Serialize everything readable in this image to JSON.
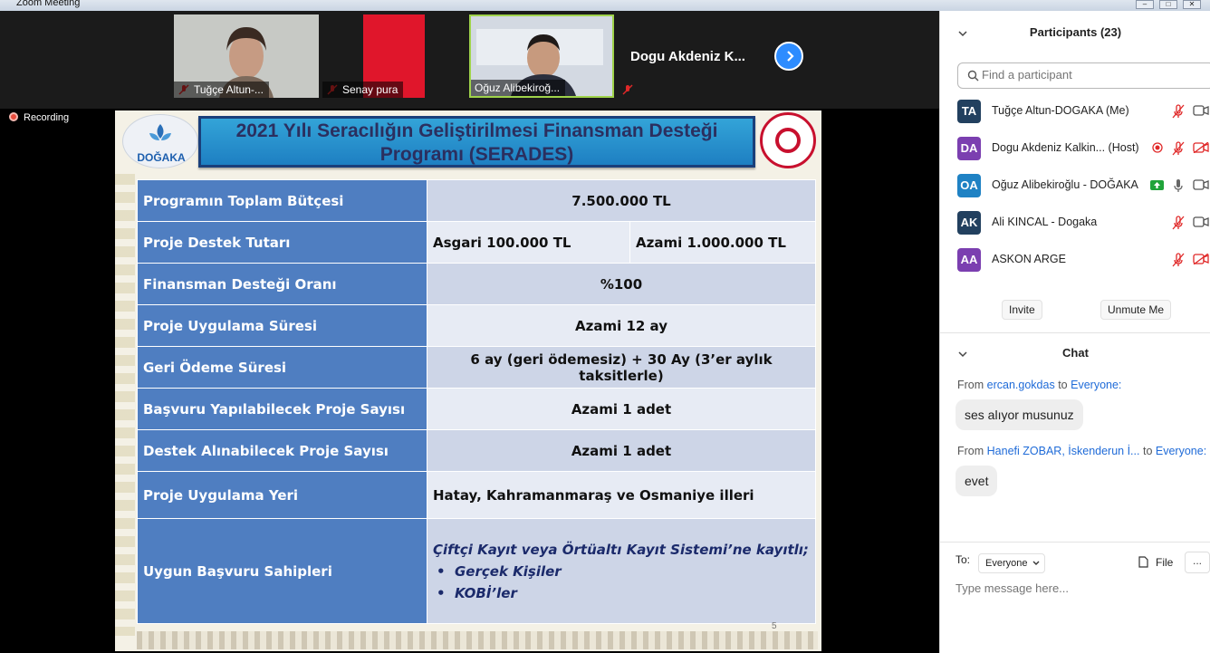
{
  "window": {
    "title": "Zoom Meeting"
  },
  "thumbnails": [
    {
      "name": "Tuğçe Altun-..."
    },
    {
      "name": "Senay pura"
    },
    {
      "name": "Oğuz Alibekiroğ..."
    },
    {
      "name": "Dogu Akdeniz K..."
    }
  ],
  "recording": {
    "label": "Recording"
  },
  "slide": {
    "logo_text": "DOĞAKA",
    "title_line1": "2021 Yılı Seracılığın Geliştirilmesi Finansman Desteği",
    "title_line2": "Programı (SERADES)",
    "rows": [
      {
        "label": "Programın Toplam Bütçesi",
        "value": "7.500.000 TL"
      },
      {
        "label": "Proje Destek Tutarı",
        "value_a": "Asgari 100.000 TL",
        "value_b": "Azami 1.000.000 TL"
      },
      {
        "label": "Finansman Desteği Oranı",
        "value": "%100"
      },
      {
        "label": "Proje Uygulama Süresi",
        "value": "Azami 12 ay"
      },
      {
        "label": "Geri Ödeme Süresi",
        "value": "6 ay (geri ödemesiz) + 30 Ay (3’er aylık taksitlerle)"
      },
      {
        "label": "Başvuru Yapılabilecek Proje Sayısı",
        "value": "Azami 1 adet"
      },
      {
        "label": "Destek Alınabilecek Proje Sayısı",
        "value": "Azami 1 adet"
      },
      {
        "label": "Proje Uygulama Yeri",
        "value": "Hatay, Kahramanmaraş ve Osmaniye illeri"
      },
      {
        "label": "Uygun Başvuru Sahipleri",
        "intro": "Çiftçi Kayıt veya Örtüaltı Kayıt Sistemi’ne kayıtlı;",
        "bullets": [
          "Gerçek Kişiler",
          "KOBİ’ler"
        ]
      }
    ],
    "page_number": "5"
  },
  "participants_panel": {
    "title": "Participants (23)",
    "search_placeholder": "Find a participant",
    "participants": [
      {
        "initials": "TA",
        "name": "Tuğçe Altun-DOGAKA (Me)",
        "color": "#22405f"
      },
      {
        "initials": "DA",
        "name": "Dogu Akdeniz Kalkin... (Host)",
        "color": "#7b3fb0"
      },
      {
        "initials": "OA",
        "name": "Oğuz Alibekiroğlu - DOĞAKA",
        "color": "#1f82c4"
      },
      {
        "initials": "AK",
        "name": "Ali KINCAL - Dogaka",
        "color": "#22405f"
      },
      {
        "initials": "AA",
        "name": "ASKON ARGE",
        "color": "#7b3fb0"
      }
    ],
    "invite_label": "Invite",
    "unmute_label": "Unmute Me"
  },
  "chat_panel": {
    "title": "Chat",
    "messages": [
      {
        "from_prefix": "From",
        "sender": "ercan.gokdas",
        "to_word": "to",
        "recipient": "Everyone:",
        "text": "ses alıyor musunuz"
      },
      {
        "from_prefix": "From",
        "sender": "Hanefi ZOBAR, İskenderun İ...",
        "to_word": "to",
        "recipient": "Everyone:",
        "text": "evet"
      }
    ],
    "to_label": "To:",
    "to_value": "Everyone",
    "file_label": "File",
    "more_label": "...",
    "input_placeholder": "Type message here..."
  },
  "colors": {
    "accent": "#2d8cff",
    "slide_label_bg": "#4f7ec1",
    "mic_muted": "#e02828",
    "active_speaker_border": "#9fd34a"
  }
}
